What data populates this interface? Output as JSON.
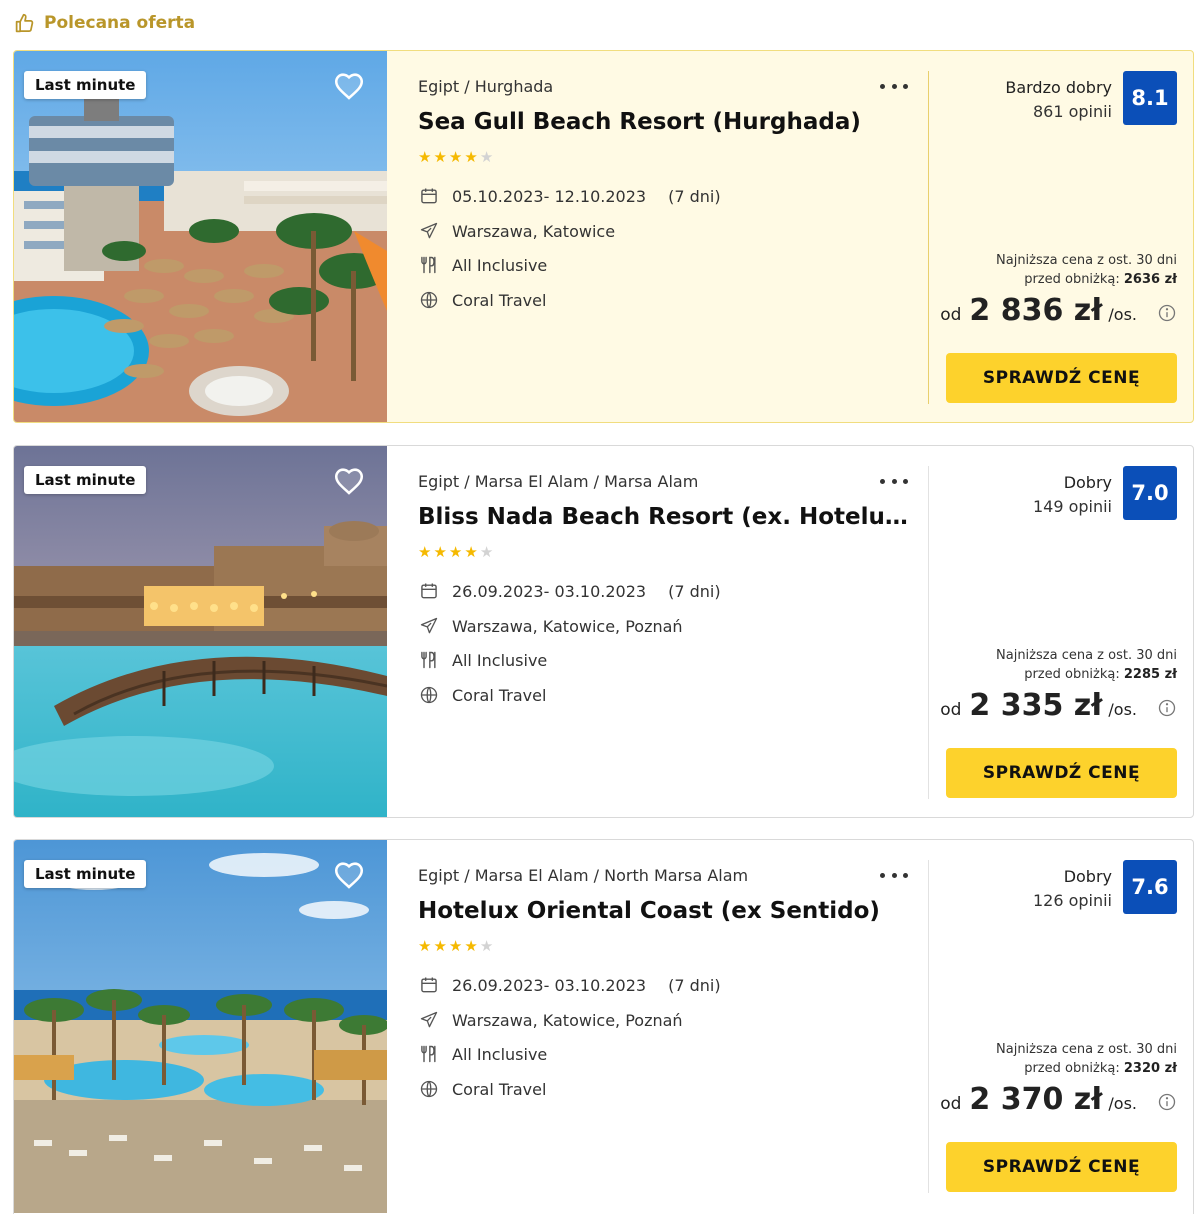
{
  "header": {
    "label": "Polecana oferta"
  },
  "offers": [
    {
      "badge": "Last minute",
      "location": "Egipt / Hurghada",
      "name": "Sea Gull Beach Resort (Hurghada)",
      "stars": 4,
      "dates": "05.10.2023- 12.10.2023",
      "duration": "(7 dni)",
      "departure": "Warszawa, Katowice",
      "board": "All Inclusive",
      "operator": "Coral Travel",
      "rating_word": "Bardzo dobry",
      "reviews": "861 opinii",
      "score": "8.1",
      "lowest_line1": "Najniższa cena z ost. 30 dni",
      "lowest_label": "przed obniżką:",
      "lowest_value": "2636 zł",
      "price_from": "od",
      "price": "2 836 zł",
      "price_per": "/os.",
      "cta": "SPRAWDŹ CENĘ"
    },
    {
      "badge": "Last minute",
      "location": "Egipt / Marsa El Alam / Marsa Alam",
      "name": "Bliss Nada Beach Resort (ex. Hotelux ...",
      "stars": 4,
      "dates": "26.09.2023- 03.10.2023",
      "duration": "(7 dni)",
      "departure": "Warszawa, Katowice, Poznań",
      "board": "All Inclusive",
      "operator": "Coral Travel",
      "rating_word": "Dobry",
      "reviews": "149 opinii",
      "score": "7.0",
      "lowest_line1": "Najniższa cena z ost. 30 dni",
      "lowest_label": "przed obniżką:",
      "lowest_value": "2285 zł",
      "price_from": "od",
      "price": "2 335 zł",
      "price_per": "/os.",
      "cta": "SPRAWDŹ CENĘ"
    },
    {
      "badge": "Last minute",
      "location": "Egipt / Marsa El Alam / North Marsa Alam",
      "name": "Hotelux Oriental Coast (ex Sentido)",
      "stars": 4,
      "dates": "26.09.2023- 03.10.2023",
      "duration": "(7 dni)",
      "departure": "Warszawa, Katowice, Poznań",
      "board": "All Inclusive",
      "operator": "Coral Travel",
      "rating_word": "Dobry",
      "reviews": "126 opinii",
      "score": "7.6",
      "lowest_line1": "Najniższa cena z ost. 30 dni",
      "lowest_label": "przed obniżką:",
      "lowest_value": "2320 zł",
      "price_from": "od",
      "price": "2 370 zł",
      "price_per": "/os.",
      "cta": "SPRAWDŹ CENĘ"
    }
  ],
  "colors": {
    "accent_gold": "#b9962a",
    "cta_yellow": "#fdd22c",
    "score_blue": "#0b4fb8",
    "featured_bg": "#fffae4"
  },
  "icons": {
    "header": "thumbs-up-icon",
    "favorite": "heart-icon",
    "more": "more-dots-icon",
    "dates": "calendar-icon",
    "departure": "plane-icon",
    "board": "cutlery-icon",
    "operator": "globe-icon",
    "price_info": "info-icon"
  }
}
